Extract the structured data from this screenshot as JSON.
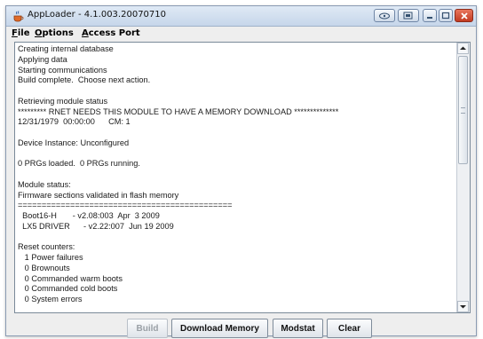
{
  "window": {
    "title": "AppLoader - 4.1.003.20070710"
  },
  "menubar": {
    "items": [
      {
        "mnemonic": "F",
        "rest": "ile"
      },
      {
        "mnemonic": "O",
        "rest": "ptions"
      },
      {
        "mnemonic": "A",
        "rest": "ccess Port"
      }
    ]
  },
  "log": {
    "lines": [
      "Creating internal database",
      "Applying data",
      "Starting communications",
      "Build complete.  Choose next action.",
      "",
      "Retrieving module status",
      "********* RNET NEEDS THIS MODULE TO HAVE A MEMORY DOWNLOAD **************",
      "12/31/1979  00:00:00      CM: 1",
      "",
      "Device Instance: Unconfigured",
      "",
      "0 PRGs loaded.  0 PRGs running.",
      "",
      "Module status:",
      "Firmware sections validated in flash memory",
      "=============================================",
      "  Boot16-H       - v2.08:003  Apr  3 2009",
      "  LX5 DRIVER      - v2.22:007  Jun 19 2009",
      "",
      "Reset counters:",
      "   1 Power failures",
      "   0 Brownouts",
      "   0 Commanded warm boots",
      "   0 Commanded cold boots",
      "   0 System errors"
    ]
  },
  "buttons": {
    "build": "Build",
    "download_memory": "Download Memory",
    "modstat": "Modstat",
    "clear": "Clear"
  },
  "colors": {
    "titlebar": "#c6d6ea",
    "close_button": "#c23b22",
    "background": "#eeeeee"
  }
}
